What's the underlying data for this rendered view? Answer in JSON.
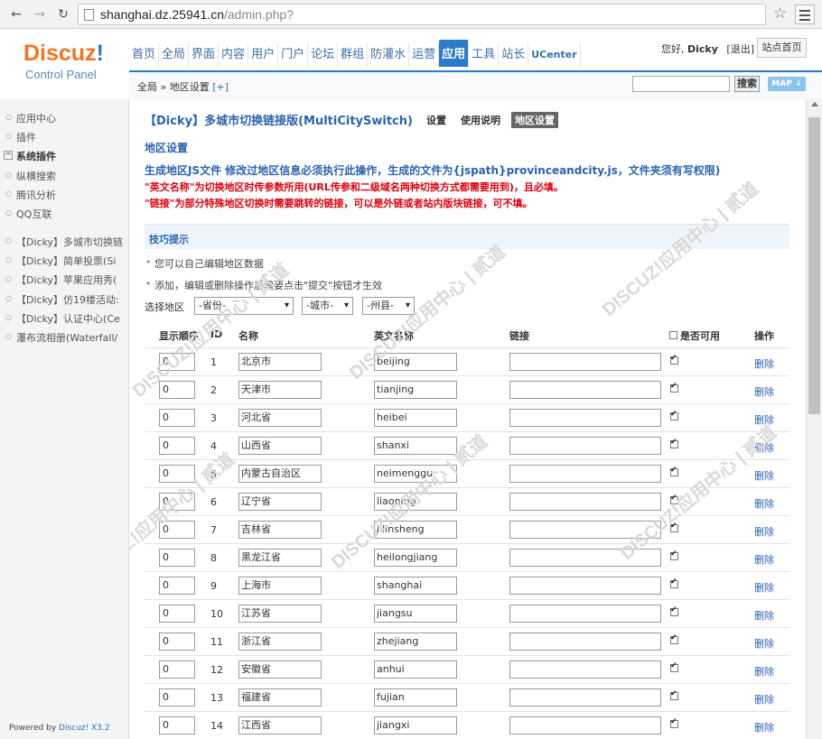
{
  "browser": {
    "url_host": "shanghai.dz.25941.cn",
    "url_path": "/admin.php?"
  },
  "header": {
    "logo": "Discuz",
    "logo_ex": "!",
    "subtitle": "Control Panel",
    "nav": [
      "首页",
      "全局",
      "界面",
      "内容",
      "用户",
      "门户",
      "论坛",
      "群组",
      "防灌水",
      "运营",
      "应用",
      "工具",
      "站长",
      "UCenter"
    ],
    "active_nav": "应用",
    "greeting": "您好,",
    "username": "Dicky",
    "logout": "[退出]",
    "site_home": "站点首页"
  },
  "breadcrumb": {
    "root": "全局",
    "sep": " » ",
    "current": "地区设置",
    "add": "[+]"
  },
  "search": {
    "button": "搜索",
    "map": "MAP ↓"
  },
  "sidebar": {
    "items": [
      "应用中心",
      "插件"
    ],
    "section": "系统插件",
    "sub": [
      "纵横搜索",
      "腾讯分析",
      "QQ互联"
    ],
    "plugins": [
      "【Dicky】多城市切换链",
      "【Dicky】简单投票(Si",
      "【Dicky】苹果应用秀(",
      "【Dicky】仿19楼活动:",
      "【Dicky】认证中心(Ce",
      "瀑布流相册(Waterfall/"
    ],
    "footer_prefix": "Powered by ",
    "footer_brand": "Discuz! X3.2"
  },
  "plugin": {
    "title": "【Dicky】多城市切换链接版(MultiCitySwitch)",
    "tabs": [
      "设置",
      "使用说明",
      "地区设置"
    ],
    "active_tab": "地区设置",
    "section_title": "地区设置",
    "info1": "生成地区JS文件 修改过地区信息必须执行此操作，生成的文件为{jspath}provinceandcity.js，文件夹须有写权限)",
    "info2": "\"英文名称\"为切换地区时传参数所用(URL传参和二级域名两种切换方式都需要用到)，且必填。",
    "info3": "\"链接\"为部分特殊地区切换时需要跳转的链接，可以是外链或者站内版块链接，可不填。",
    "tips_title": "技巧提示",
    "tips": [
      "您可以自己编辑地区数据",
      "添加，编辑或删除操作后需要点击\"提交\"按钮才生效"
    ],
    "region_label": "选择地区",
    "selects": [
      "-省份-",
      "-城市-",
      "-州县-"
    ]
  },
  "table": {
    "headers": {
      "order": "显示顺序",
      "id": "ID",
      "name": "名称",
      "en": "英文名称",
      "link": "链接",
      "avail": "是否可用",
      "op": "操作"
    },
    "rows": [
      {
        "order": "0",
        "id": "1",
        "name": "北京市",
        "en": "beijing"
      },
      {
        "order": "0",
        "id": "2",
        "name": "天津市",
        "en": "tianjing"
      },
      {
        "order": "0",
        "id": "3",
        "name": "河北省",
        "en": "heibei"
      },
      {
        "order": "0",
        "id": "4",
        "name": "山西省",
        "en": "shanxi"
      },
      {
        "order": "0",
        "id": "5",
        "name": "内蒙古自治区",
        "en": "neimenggu"
      },
      {
        "order": "0",
        "id": "6",
        "name": "辽宁省",
        "en": "liaoning"
      },
      {
        "order": "0",
        "id": "7",
        "name": "吉林省",
        "en": "jilinsheng"
      },
      {
        "order": "0",
        "id": "8",
        "name": "黑龙江省",
        "en": "heilongjiang"
      },
      {
        "order": "0",
        "id": "9",
        "name": "上海市",
        "en": "shanghai"
      },
      {
        "order": "0",
        "id": "10",
        "name": "江苏省",
        "en": "jiangsu"
      },
      {
        "order": "0",
        "id": "11",
        "name": "浙江省",
        "en": "zhejiang"
      },
      {
        "order": "0",
        "id": "12",
        "name": "安徽省",
        "en": "anhui"
      },
      {
        "order": "0",
        "id": "13",
        "name": "福建省",
        "en": "fujian"
      },
      {
        "order": "0",
        "id": "14",
        "name": "江西省",
        "en": "jiangxi"
      }
    ],
    "delete_label": "删除"
  },
  "watermark": "DISCUZ!应用中心 | 贰道"
}
